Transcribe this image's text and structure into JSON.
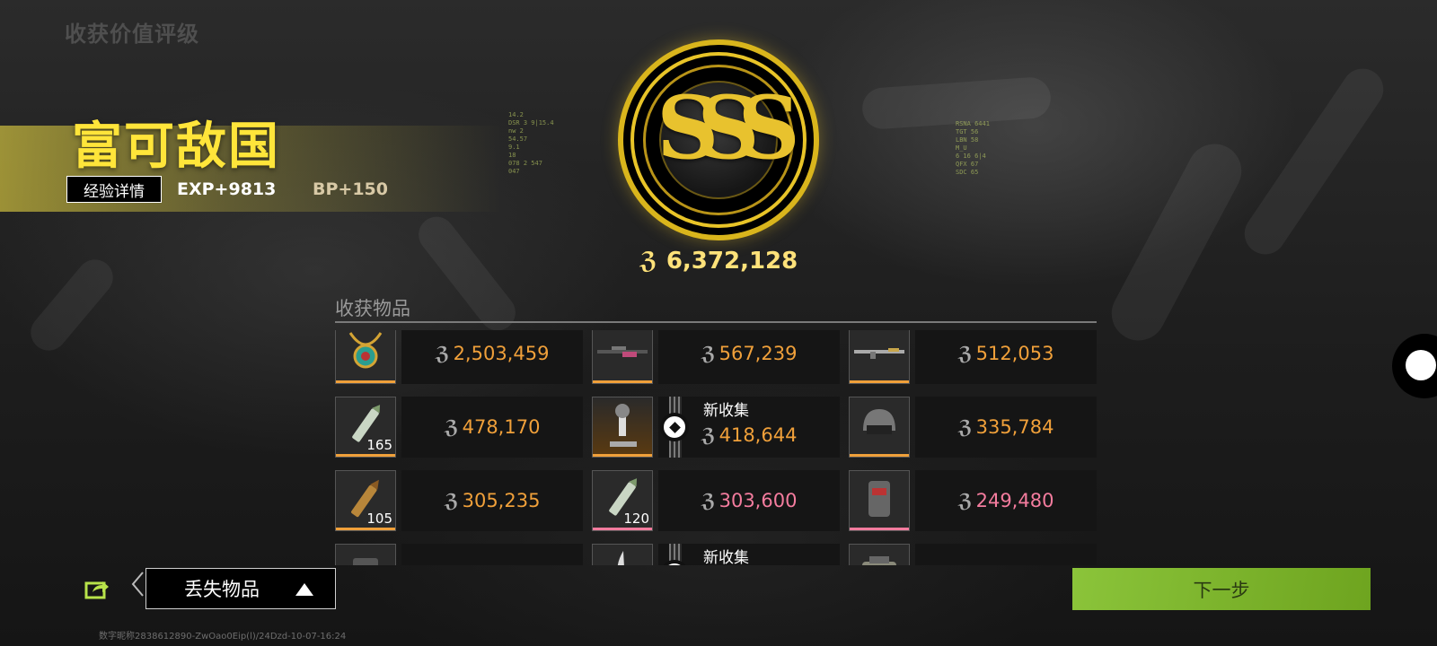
{
  "header": {
    "section_title": "收获价值评级"
  },
  "rating": {
    "title": "富可敌国",
    "exp_detail_label": "经验详情",
    "exp": "EXP+9813",
    "bp": "BP+150",
    "grade": "SSS"
  },
  "hud_left": [
    "14.2",
    "DSR 3  9|15.4",
    "nw 2",
    "54.57",
    "9.1",
    "18",
    "078 2 547",
    "047"
  ],
  "hud_right": [
    "RSNA  6441",
    "TGT    56",
    "LBN      58",
    "M_U",
    "6  16  6|4",
    "QFX  67",
    "SDC  65"
  ],
  "total": {
    "currency_symbol": "ℨ",
    "value": "6,372,128"
  },
  "items_section": {
    "label": "收获物品"
  },
  "items": [
    {
      "icon": "necklace-icon",
      "thumb_style": "dark",
      "count": "",
      "value": "2,503,459",
      "value_color": "orange",
      "bar_color": "#f0a03a",
      "is_new": false,
      "new_label": ""
    },
    {
      "icon": "sniper-rifle-icon",
      "thumb_style": "dark",
      "count": "",
      "value": "567,239",
      "value_color": "orange",
      "bar_color": "#f0a03a",
      "is_new": false,
      "new_label": ""
    },
    {
      "icon": "assault-rifle-icon",
      "thumb_style": "dark",
      "count": "",
      "value": "512,053",
      "value_color": "orange",
      "bar_color": "#f0a03a",
      "is_new": false,
      "new_label": ""
    },
    {
      "icon": "bullet-green-icon",
      "thumb_style": "dark",
      "count": "165",
      "value": "478,170",
      "value_color": "orange",
      "bar_color": "#f0a03a",
      "is_new": false,
      "new_label": ""
    },
    {
      "icon": "microscope-icon",
      "thumb_style": "gold",
      "count": "",
      "value": "418,644",
      "value_color": "orange",
      "bar_color": "#f0a03a",
      "is_new": true,
      "new_label": "新收集"
    },
    {
      "icon": "helmet-icon",
      "thumb_style": "dark",
      "count": "",
      "value": "335,784",
      "value_color": "orange",
      "bar_color": "#f0a03a",
      "is_new": false,
      "new_label": ""
    },
    {
      "icon": "bullet-brass-icon",
      "thumb_style": "dark",
      "count": "105",
      "value": "305,235",
      "value_color": "orange",
      "bar_color": "#f0a03a",
      "is_new": false,
      "new_label": ""
    },
    {
      "icon": "bullet-green-icon",
      "thumb_style": "dark",
      "count": "120",
      "value": "303,600",
      "value_color": "pink",
      "bar_color": "#f47c9e",
      "is_new": false,
      "new_label": ""
    },
    {
      "icon": "body-armor-icon",
      "thumb_style": "dark",
      "count": "",
      "value": "249,480",
      "value_color": "pink",
      "bar_color": "#f47c9e",
      "is_new": false,
      "new_label": ""
    },
    {
      "icon": "vest-icon",
      "thumb_style": "dark",
      "count": "",
      "value": "",
      "value_color": "orange",
      "bar_color": "#f0a03a",
      "is_new": false,
      "new_label": ""
    },
    {
      "icon": "knife-icon",
      "thumb_style": "dark",
      "count": "",
      "value": "",
      "value_color": "orange",
      "bar_color": "#f0a03a",
      "is_new": true,
      "new_label": "新收集"
    },
    {
      "icon": "backpack-icon",
      "thumb_style": "dark",
      "count": "",
      "value": "",
      "value_color": "orange",
      "bar_color": "#f0a03a",
      "is_new": false,
      "new_label": ""
    }
  ],
  "footer": {
    "lost_items_label": "丢失物品",
    "next_label": "下一步",
    "watermark": "数字昵称2838612890-ZwOao0Eip(l)/24Dzd-10-07-16:24"
  }
}
